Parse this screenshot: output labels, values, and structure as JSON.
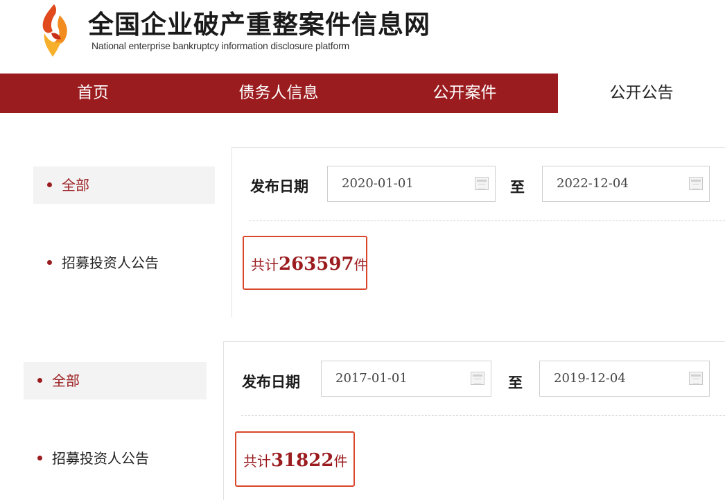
{
  "site": {
    "title": "全国企业破产重整案件信息网",
    "subtitle": "National enterprise bankruptcy  information disclosure platform"
  },
  "nav": {
    "items": [
      "首页",
      "债务人信息",
      "公开案件",
      "公开公告"
    ],
    "active_index": 3
  },
  "colors": {
    "brand_red": "#9b1c1f",
    "highlight_border": "#d9472b"
  },
  "panels": [
    {
      "sidebar": {
        "all": "全部",
        "recruit": "招募投资人公告"
      },
      "filter": {
        "label": "发布日期",
        "start": "2020-01-01",
        "separator": "至",
        "end": "2022-12-04"
      },
      "count": {
        "prefix": "共计",
        "value": "263597",
        "suffix": "件"
      }
    },
    {
      "sidebar": {
        "all": "全部",
        "recruit": "招募投资人公告"
      },
      "filter": {
        "label": "发布日期",
        "start": "2017-01-01",
        "separator": "至",
        "end": "2019-12-04"
      },
      "count": {
        "prefix": "共计",
        "value": "31822",
        "suffix": "件"
      }
    }
  ]
}
